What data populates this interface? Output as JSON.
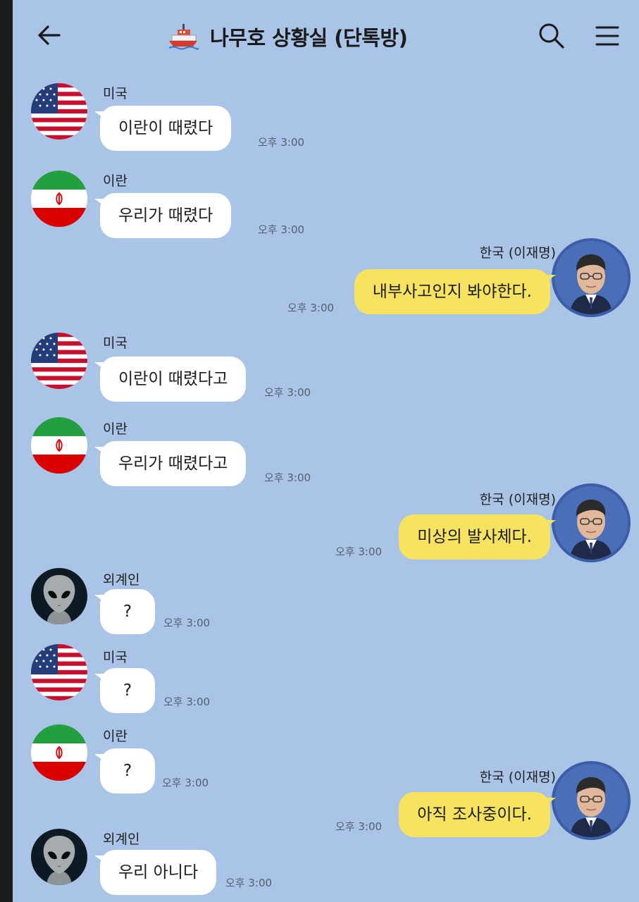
{
  "header": {
    "title": "나무호 상황실 (단톡방)"
  },
  "messages": [
    {
      "sender": "미국",
      "text": "이란이 때렸다",
      "time": "오후 3:00",
      "side": "in",
      "avatar": "us-flag"
    },
    {
      "sender": "이란",
      "text": "우리가 때렸다",
      "time": "오후 3:00",
      "side": "in",
      "avatar": "iran-flag"
    },
    {
      "sender": "한국 (이재명)",
      "text": "내부사고인지 봐야한다.",
      "time": "오후 3:00",
      "side": "out",
      "avatar": "person-photo"
    },
    {
      "sender": "미국",
      "text": "이란이 때렸다고",
      "time": "오후 3:00",
      "side": "in",
      "avatar": "us-flag"
    },
    {
      "sender": "이란",
      "text": "우리가 때렸다고",
      "time": "오후 3:00",
      "side": "in",
      "avatar": "iran-flag"
    },
    {
      "sender": "한국 (이재명)",
      "text": "미상의 발사체다.",
      "time": "오후 3:00",
      "side": "out",
      "avatar": "person-photo"
    },
    {
      "sender": "외계인",
      "text": "?",
      "time": "오후 3:00",
      "side": "in",
      "avatar": "alien"
    },
    {
      "sender": "미국",
      "text": "?",
      "time": "오후 3:00",
      "side": "in",
      "avatar": "us-flag"
    },
    {
      "sender": "이란",
      "text": "?",
      "time": "오후 3:00",
      "side": "in",
      "avatar": "iran-flag"
    },
    {
      "sender": "한국 (이재명)",
      "text": "아직 조사중이다.",
      "time": "오후 3:00",
      "side": "out",
      "avatar": "person-photo"
    },
    {
      "sender": "외계인",
      "text": "우리 아니다",
      "time": "오후 3:00",
      "side": "in",
      "avatar": "alien"
    }
  ],
  "colors": {
    "chat_background": "#a9c4e6",
    "incoming_bubble": "#ffffff",
    "outgoing_bubble": "#f7e35f"
  }
}
